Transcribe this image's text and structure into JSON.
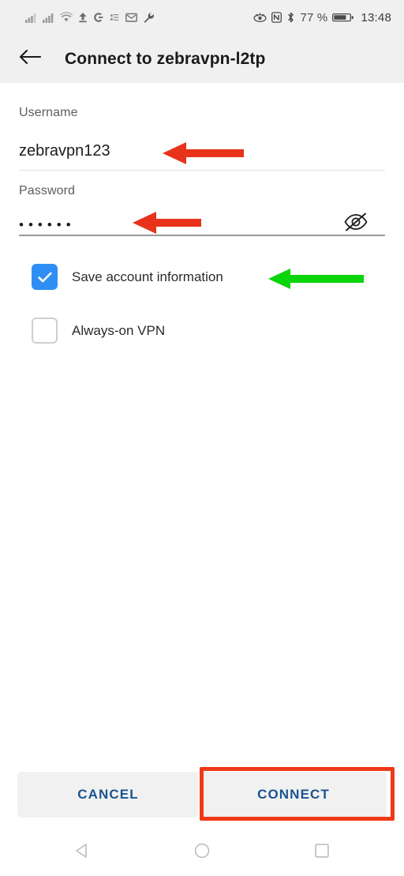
{
  "status_bar": {
    "icons_left": [
      "signal-bars-sim1-icon",
      "signal-bars-sim2-icon",
      "wifi-icon",
      "upload-arrow-icon",
      "google-g-icon",
      "dots-sync-icon",
      "gmail-envelope-icon",
      "wrench-icon"
    ],
    "icons_right": [
      "eye-care-icon",
      "nfc-icon",
      "bluetooth-icon"
    ],
    "battery_percent": "77 %",
    "battery_icon": "battery-icon",
    "time": "13:48"
  },
  "app_bar": {
    "back_icon": "back-arrow-icon",
    "title": "Connect to zebravpn-l2tp"
  },
  "form": {
    "username": {
      "label": "Username",
      "value": "zebravpn123",
      "placeholder": "Username"
    },
    "password": {
      "label": "Password",
      "value": "••••••",
      "placeholder": "Password",
      "masked_char_count": 6,
      "toggle_icon": "eye-off-icon"
    },
    "checkboxes": [
      {
        "label": "Save account information",
        "checked": true
      },
      {
        "label": "Always-on VPN",
        "checked": false
      }
    ]
  },
  "buttons": {
    "cancel_label": "CANCEL",
    "connect_label": "CONNECT"
  },
  "navigation_bar": {
    "back_icon": "nav-back-triangle-icon",
    "home_icon": "nav-home-circle-icon",
    "recents_icon": "nav-recents-square-icon"
  },
  "annotations": [
    {
      "name": "red-arrow-username",
      "color": "#e8331a",
      "points_to": "username value field"
    },
    {
      "name": "red-arrow-password",
      "color": "#e8331a",
      "points_to": "password value field"
    },
    {
      "name": "green-arrow-save-account",
      "color": "#0ad40a",
      "points_to": "Save account information checkbox"
    },
    {
      "name": "red-highlight-connect",
      "color": "#ef3a17",
      "points_to": "CONNECT button"
    }
  ],
  "colors": {
    "accent_checkbox": "#2f8ef4",
    "button_text": "#1a5490",
    "bar_background": "#f0f0f0",
    "page_background": "#ffffff",
    "annotation_red": "#e8331a",
    "annotation_green": "#0ad40a",
    "highlight_red": "#ef3a17"
  }
}
